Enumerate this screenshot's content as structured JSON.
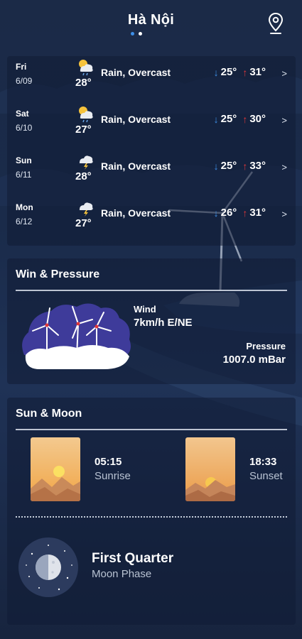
{
  "header": {
    "city": "Hà Nội",
    "location_icon": "location-pin-icon",
    "page_indicator": {
      "pages": 2,
      "active": 1
    }
  },
  "forecast": [
    {
      "day": "Fri",
      "date": "6/09",
      "icon": "rain-cloud-sun-icon",
      "temp": "28°",
      "condition": "Rain, Overcast",
      "low": "25°",
      "high": "31°"
    },
    {
      "day": "Sat",
      "date": "6/10",
      "icon": "rain-cloud-sun-icon",
      "temp": "27°",
      "condition": "Rain, Overcast",
      "low": "25°",
      "high": "30°"
    },
    {
      "day": "Sun",
      "date": "6/11",
      "icon": "thunder-cloud-icon",
      "temp": "28°",
      "condition": "Rain, Overcast",
      "low": "25°",
      "high": "33°"
    },
    {
      "day": "Mon",
      "date": "6/12",
      "icon": "thunder-cloud-icon",
      "temp": "27°",
      "condition": "Rain, Overcast",
      "low": "26°",
      "high": "31°"
    }
  ],
  "wind_pressure": {
    "title": "Win & Pressure",
    "wind_label": "Wind",
    "wind_value": "7km/h E/NE",
    "pressure_label": "Pressure",
    "pressure_value": "1007.0 mBar"
  },
  "sun_moon": {
    "title": "Sun & Moon",
    "sunrise_time": "05:15",
    "sunrise_label": "Sunrise",
    "sunset_time": "18:33",
    "sunset_label": "Sunset",
    "moon_phase": "First Quarter",
    "moon_label": "Moon Phase"
  },
  "colors": {
    "background": "#1b2a47",
    "accent_blue": "#3d8fe8",
    "high_red": "#e0373a",
    "wind_illus_bg": "#3e3b9a"
  }
}
